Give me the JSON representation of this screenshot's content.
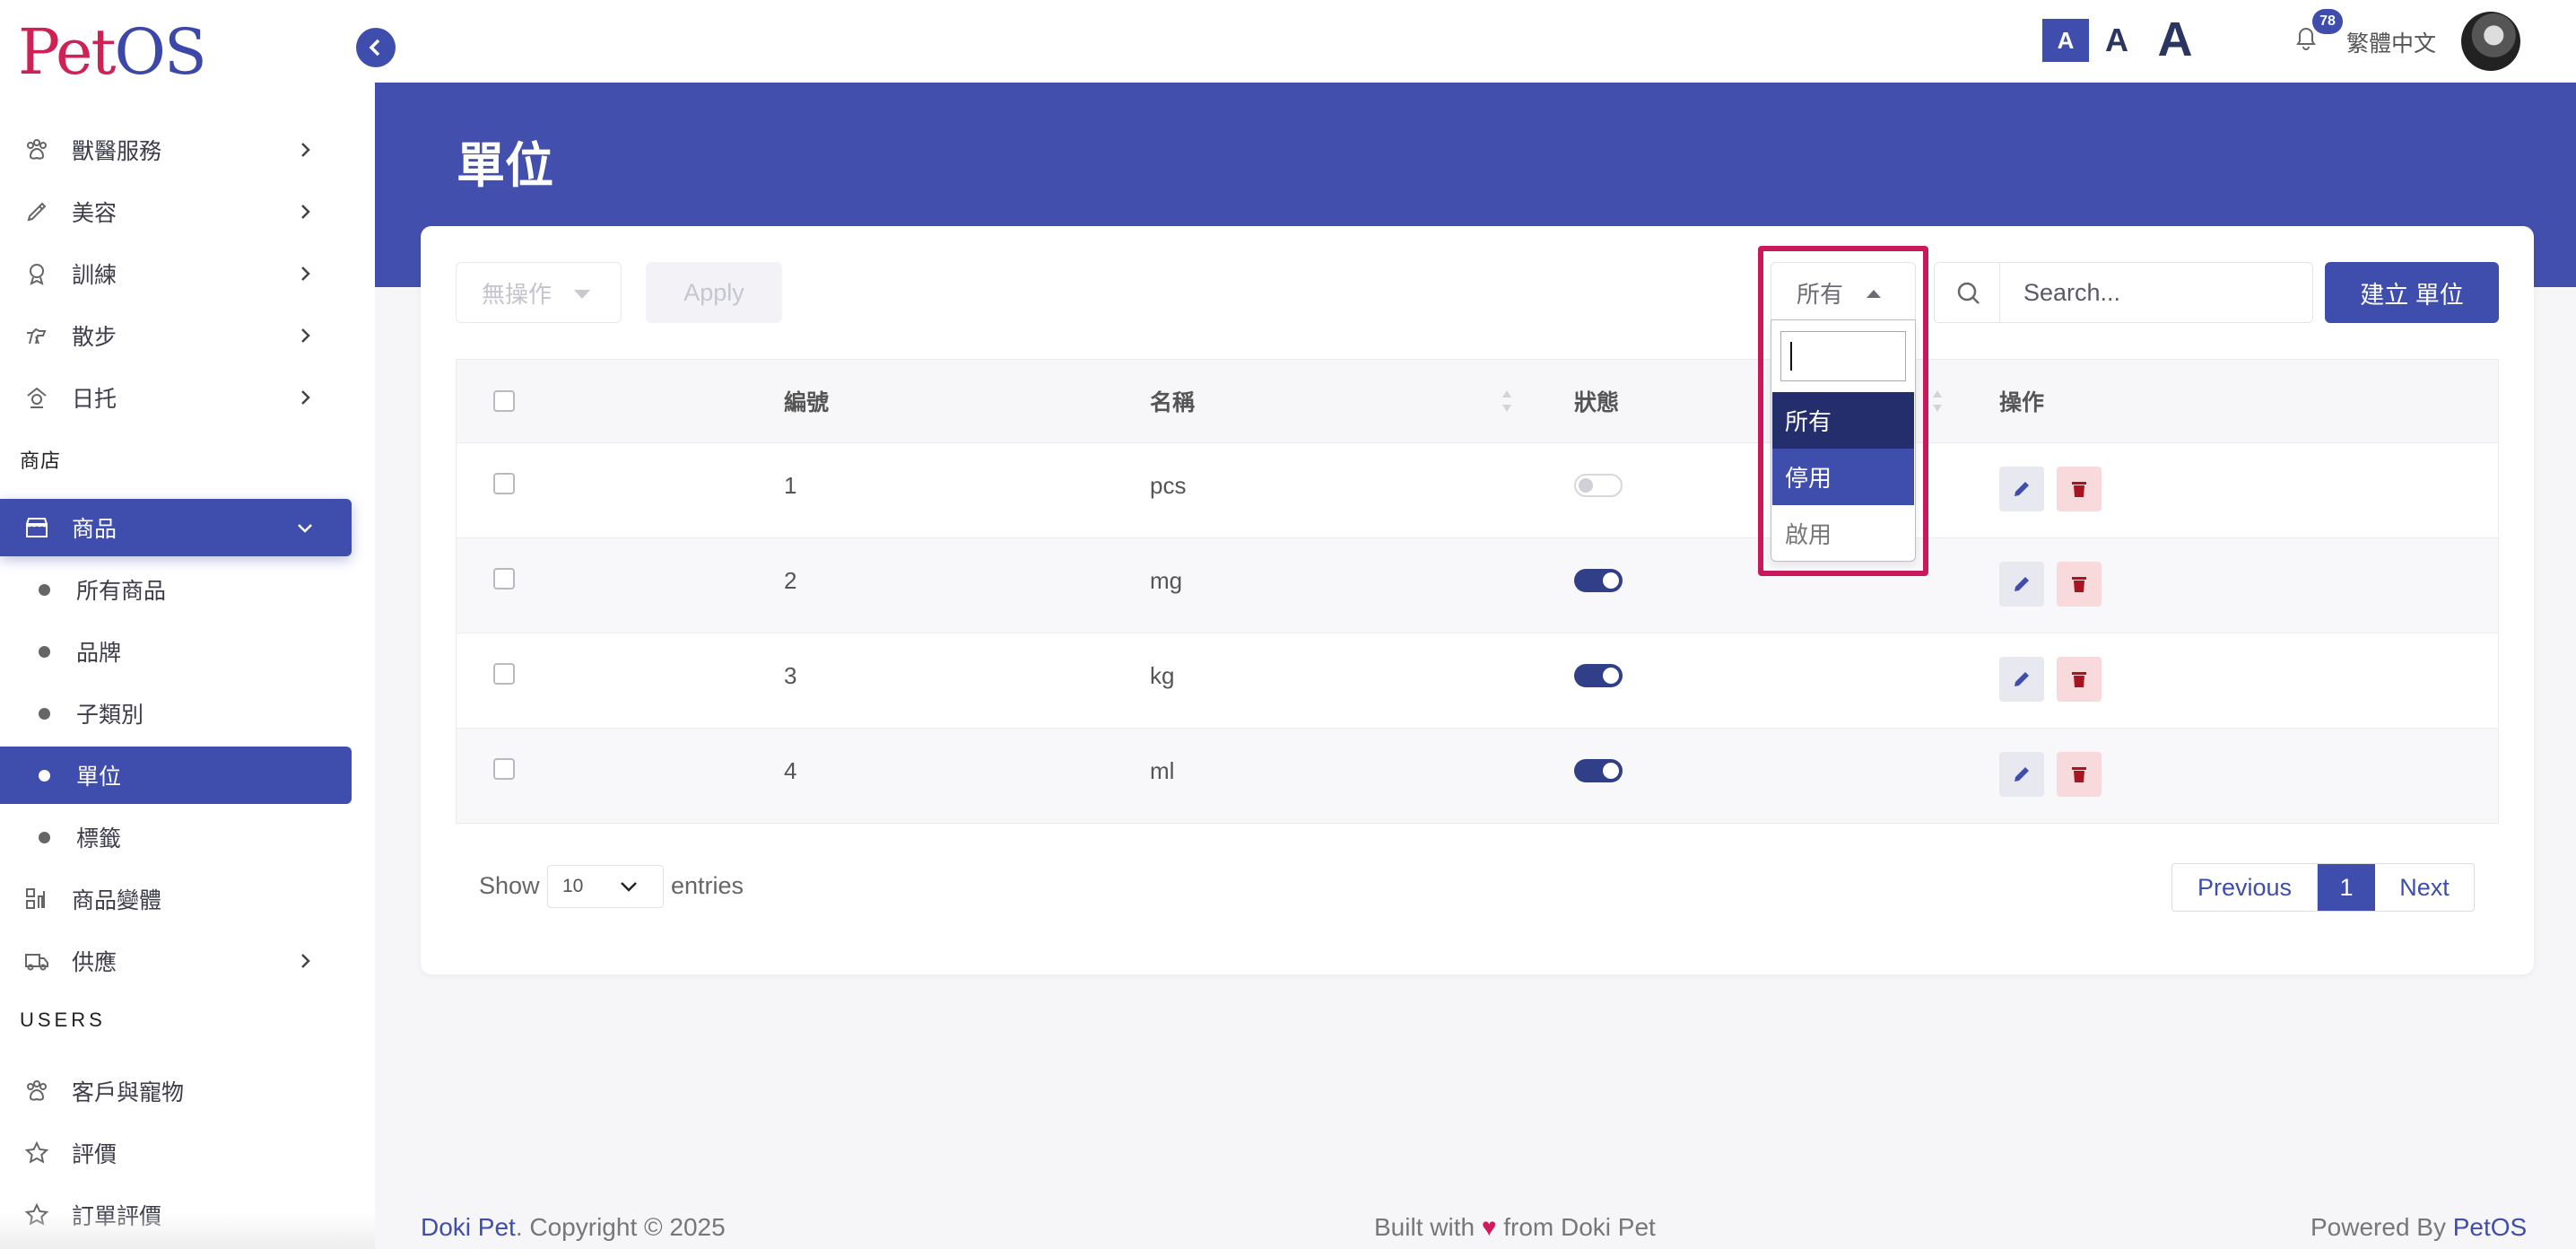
{
  "app": {
    "logo_p": "P",
    "logo_et": "et",
    "logo_os": "OS"
  },
  "sidebar": {
    "items": [
      {
        "label": "獸醫服務",
        "icon": "paw-icon",
        "has_chevron": true
      },
      {
        "label": "美容",
        "icon": "brush-icon",
        "has_chevron": true
      },
      {
        "label": "訓練",
        "icon": "trophy-icon",
        "has_chevron": true
      },
      {
        "label": "散步",
        "icon": "dog-walk-icon",
        "has_chevron": true
      },
      {
        "label": "日托",
        "icon": "daycare-icon",
        "has_chevron": true
      }
    ],
    "section_shop": "商店",
    "products": {
      "label": "商品",
      "icon": "store-icon",
      "expanded": true
    },
    "sub_items": [
      {
        "label": "所有商品"
      },
      {
        "label": "品牌"
      },
      {
        "label": "子類別"
      },
      {
        "label": "單位",
        "active": true
      },
      {
        "label": "標籤"
      }
    ],
    "variants": {
      "label": "商品變體",
      "icon": "variants-icon"
    },
    "supply": {
      "label": "供應",
      "icon": "truck-icon"
    },
    "section_users": "USERS",
    "users_items": [
      {
        "label": "客戶與寵物",
        "icon": "paw-icon"
      },
      {
        "label": "評價",
        "icon": "star-icon"
      },
      {
        "label": "訂單評價",
        "icon": "star-icon"
      }
    ]
  },
  "topbar": {
    "font_small": "A",
    "font_medium": "A",
    "font_large": "A",
    "notifications_count": "78",
    "language": "繁體中文"
  },
  "page": {
    "title": "單位"
  },
  "toolbar": {
    "bulk_action": "無操作",
    "apply": "Apply",
    "status_filter": "所有",
    "search_placeholder": "Search...",
    "create": "建立 單位"
  },
  "status_dropdown": {
    "search_value": "",
    "options": [
      {
        "label": "所有",
        "state": "selected"
      },
      {
        "label": "停用",
        "state": "hovered"
      },
      {
        "label": "啟用",
        "state": "normal"
      }
    ]
  },
  "table": {
    "columns": [
      "編號",
      "名稱",
      "狀態",
      "操作"
    ],
    "rows": [
      {
        "id": "1",
        "name": "pcs",
        "enabled": false
      },
      {
        "id": "2",
        "name": "mg",
        "enabled": true
      },
      {
        "id": "3",
        "name": "kg",
        "enabled": true
      },
      {
        "id": "4",
        "name": "ml",
        "enabled": true
      }
    ]
  },
  "pagination": {
    "show": "Show",
    "page_size": "10",
    "entries": "entries",
    "previous": "Previous",
    "current": "1",
    "next": "Next"
  },
  "footer": {
    "left_brand": "Doki Pet",
    "left_rest": ". Copyright © 2025",
    "mid_a": "Built with ",
    "heart": "♥",
    "mid_b": " from Doki Pet",
    "right_a": "Powered By ",
    "right_brand": "PetOS"
  },
  "colors": {
    "primary": "#3f4eac",
    "header_band": "#424fac",
    "brand_red": "#cc2256",
    "highlight": "#c8195d",
    "delete": "#a8141f"
  }
}
